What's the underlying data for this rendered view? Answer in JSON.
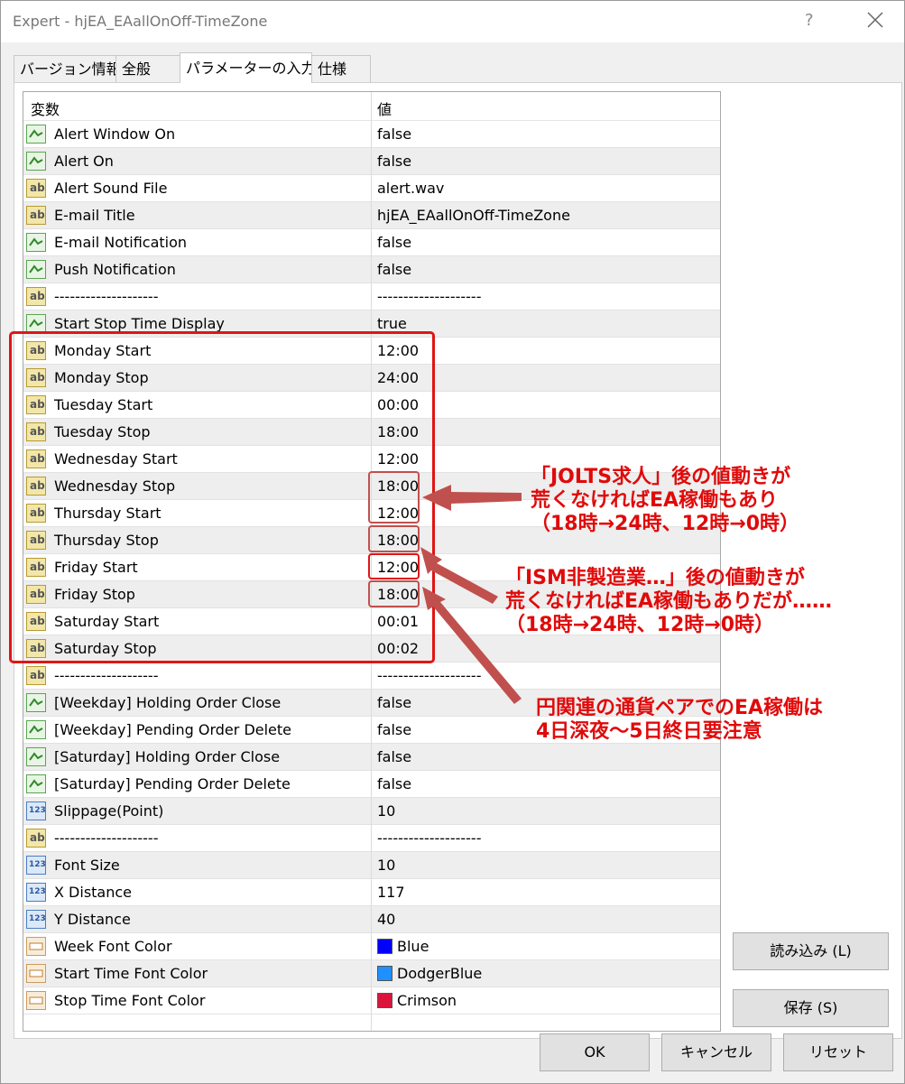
{
  "window": {
    "title": "Expert - hjEA_EAallOnOff-TimeZone",
    "help": "?"
  },
  "tabs": [
    {
      "label": "バージョン情報"
    },
    {
      "label": "全般"
    },
    {
      "label": "パラメーターの入力"
    },
    {
      "label": "仕様"
    }
  ],
  "grid": {
    "headers": {
      "variable": "変数",
      "value": "値"
    },
    "rows": [
      {
        "name": "Alert Window On",
        "value": "false",
        "icon": "bool-icon"
      },
      {
        "name": "Alert On",
        "value": "false",
        "icon": "bool-icon"
      },
      {
        "name": "Alert Sound File",
        "value": "alert.wav",
        "icon": "string-icon"
      },
      {
        "name": "E-mail Title",
        "value": "hjEA_EAallOnOff-TimeZone",
        "icon": "string-icon"
      },
      {
        "name": "E-mail Notification",
        "value": "false",
        "icon": "bool-icon"
      },
      {
        "name": "Push Notification",
        "value": "false",
        "icon": "bool-icon"
      },
      {
        "name": "--------------------",
        "value": "--------------------",
        "icon": "string-icon"
      },
      {
        "name": "Start Stop Time Display",
        "value": "true",
        "icon": "bool-icon"
      },
      {
        "name": "Monday Start",
        "value": "12:00",
        "icon": "string-icon"
      },
      {
        "name": "Monday Stop",
        "value": "24:00",
        "icon": "string-icon"
      },
      {
        "name": "Tuesday Start",
        "value": "00:00",
        "icon": "string-icon"
      },
      {
        "name": "Tuesday Stop",
        "value": "18:00",
        "icon": "string-icon"
      },
      {
        "name": "Wednesday Start",
        "value": "12:00",
        "icon": "string-icon"
      },
      {
        "name": "Wednesday Stop",
        "value": "18:00",
        "icon": "string-icon"
      },
      {
        "name": "Thursday Start",
        "value": "12:00",
        "icon": "string-icon"
      },
      {
        "name": "Thursday Stop",
        "value": "18:00",
        "icon": "string-icon"
      },
      {
        "name": "Friday Start",
        "value": "12:00",
        "icon": "string-icon"
      },
      {
        "name": "Friday Stop",
        "value": "18:00",
        "icon": "string-icon"
      },
      {
        "name": "Saturday Start",
        "value": "00:01",
        "icon": "string-icon"
      },
      {
        "name": "Saturday Stop",
        "value": "00:02",
        "icon": "string-icon"
      },
      {
        "name": "--------------------",
        "value": "--------------------",
        "icon": "string-icon"
      },
      {
        "name": "[Weekday]  Holding Order Close",
        "value": "false",
        "icon": "bool-icon"
      },
      {
        "name": "[Weekday]  Pending Order Delete",
        "value": "false",
        "icon": "bool-icon"
      },
      {
        "name": "[Saturday]   Holding Order Close",
        "value": "false",
        "icon": "bool-icon"
      },
      {
        "name": "[Saturday]   Pending Order Delete",
        "value": "false",
        "icon": "bool-icon"
      },
      {
        "name": "Slippage(Point)",
        "value": "10",
        "icon": "number-icon"
      },
      {
        "name": "--------------------",
        "value": "--------------------",
        "icon": "string-icon"
      },
      {
        "name": "Font Size",
        "value": "10",
        "icon": "number-icon"
      },
      {
        "name": "X Distance",
        "value": "117",
        "icon": "number-icon"
      },
      {
        "name": "Y Distance",
        "value": "40",
        "icon": "number-icon"
      },
      {
        "name": "Week Font Color",
        "value": "Blue",
        "icon": "color-icon",
        "swatch": "#0000ff"
      },
      {
        "name": "Start Time Font Color",
        "value": "DodgerBlue",
        "icon": "color-icon",
        "swatch": "#1e90ff"
      },
      {
        "name": "Stop Time Font Color",
        "value": "Crimson",
        "icon": "color-icon",
        "swatch": "#dc143c"
      }
    ]
  },
  "buttons": {
    "load": "読み込み (L)",
    "save": "保存 (S)",
    "ok": "OK",
    "cancel": "キャンセル",
    "reset": "リセット"
  },
  "annotations": {
    "callout1": [
      "「JOLTS求人」後の値動きが",
      "荒くなければEA稼働もあり",
      "（18時→24時、12時→0時）"
    ],
    "callout2": [
      "「ISM非製造業…」後の値動きが",
      "荒くなければEA稼働もありだが……",
      "（18時→24時、12時→0時）"
    ],
    "callout3": [
      "円関連の通貨ペアでのEA稼働は",
      "4日深夜～5日終日要注意"
    ],
    "color": "#e00a0a"
  }
}
